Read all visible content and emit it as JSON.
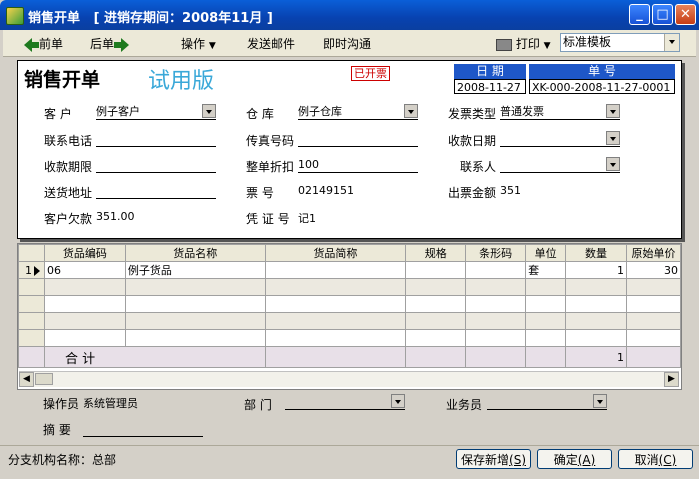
{
  "window": {
    "title": "销售开单   [ 进销存期间：2008年11月 ]",
    "controls": {
      "minimize": "_",
      "maximize": "□",
      "close": "✕"
    }
  },
  "toolbar": {
    "prev": "前单",
    "next": "后单",
    "operate": "操作",
    "send_email": "发送邮件",
    "instant_chat": "即时沟通",
    "print": "打印",
    "template": "标准模板"
  },
  "form": {
    "title": "销售开单",
    "trial": "试用版",
    "invoiced_stamp": "已开票",
    "date_header": "日 期",
    "date_value": "2008-11-27",
    "number_header": "单 号",
    "number_value": "XK-000-2008-11-27-0001",
    "customer_label": "客    户",
    "customer_value": "例子客户",
    "warehouse_label": "仓    库",
    "warehouse_value": "例子仓库",
    "invoice_type_label": "发票类型",
    "invoice_type_value": "普通发票",
    "phone_label": "联系电话",
    "phone_value": "",
    "fax_label": "传真号码",
    "fax_value": "",
    "receive_date_label": "收款日期",
    "receive_date_value": "",
    "term_label": "收款期限",
    "term_value": "",
    "discount_label": "整单折扣",
    "discount_value": "100",
    "contact_label": "联系人",
    "contact_value": "",
    "delivery_label": "送货地址",
    "delivery_value": "",
    "ticket_label": "票    号",
    "ticket_value": "02149151",
    "invoice_amount_label": "出票金额",
    "invoice_amount_value": "351",
    "debt_label": "客户欠款",
    "debt_value": "351.00",
    "voucher_label": "凭 证 号",
    "voucher_value": "记1"
  },
  "grid": {
    "columns": [
      "货品编码",
      "货品名称",
      "货品简称",
      "规格",
      "条形码",
      "单位",
      "数量",
      "原始单价"
    ],
    "rows": [
      [
        "06",
        "例子货品",
        "",
        "",
        "",
        "套",
        "1",
        "30"
      ]
    ],
    "row_number": "1",
    "total_label": "合    计",
    "total_qty": "1"
  },
  "footer": {
    "operator_label": "操作员",
    "operator_value": "系统管理员",
    "dept_label": "部    门",
    "dept_value": "",
    "salesman_label": "业务员",
    "salesman_value": "",
    "memo_label": "摘    要",
    "memo_value": "",
    "branch": "分支机构名称：总部",
    "save_new": "保存新增",
    "save_new_key": "(S)",
    "ok": "确定",
    "ok_key": "(A)",
    "cancel": "取消",
    "cancel_key": "(C)"
  }
}
